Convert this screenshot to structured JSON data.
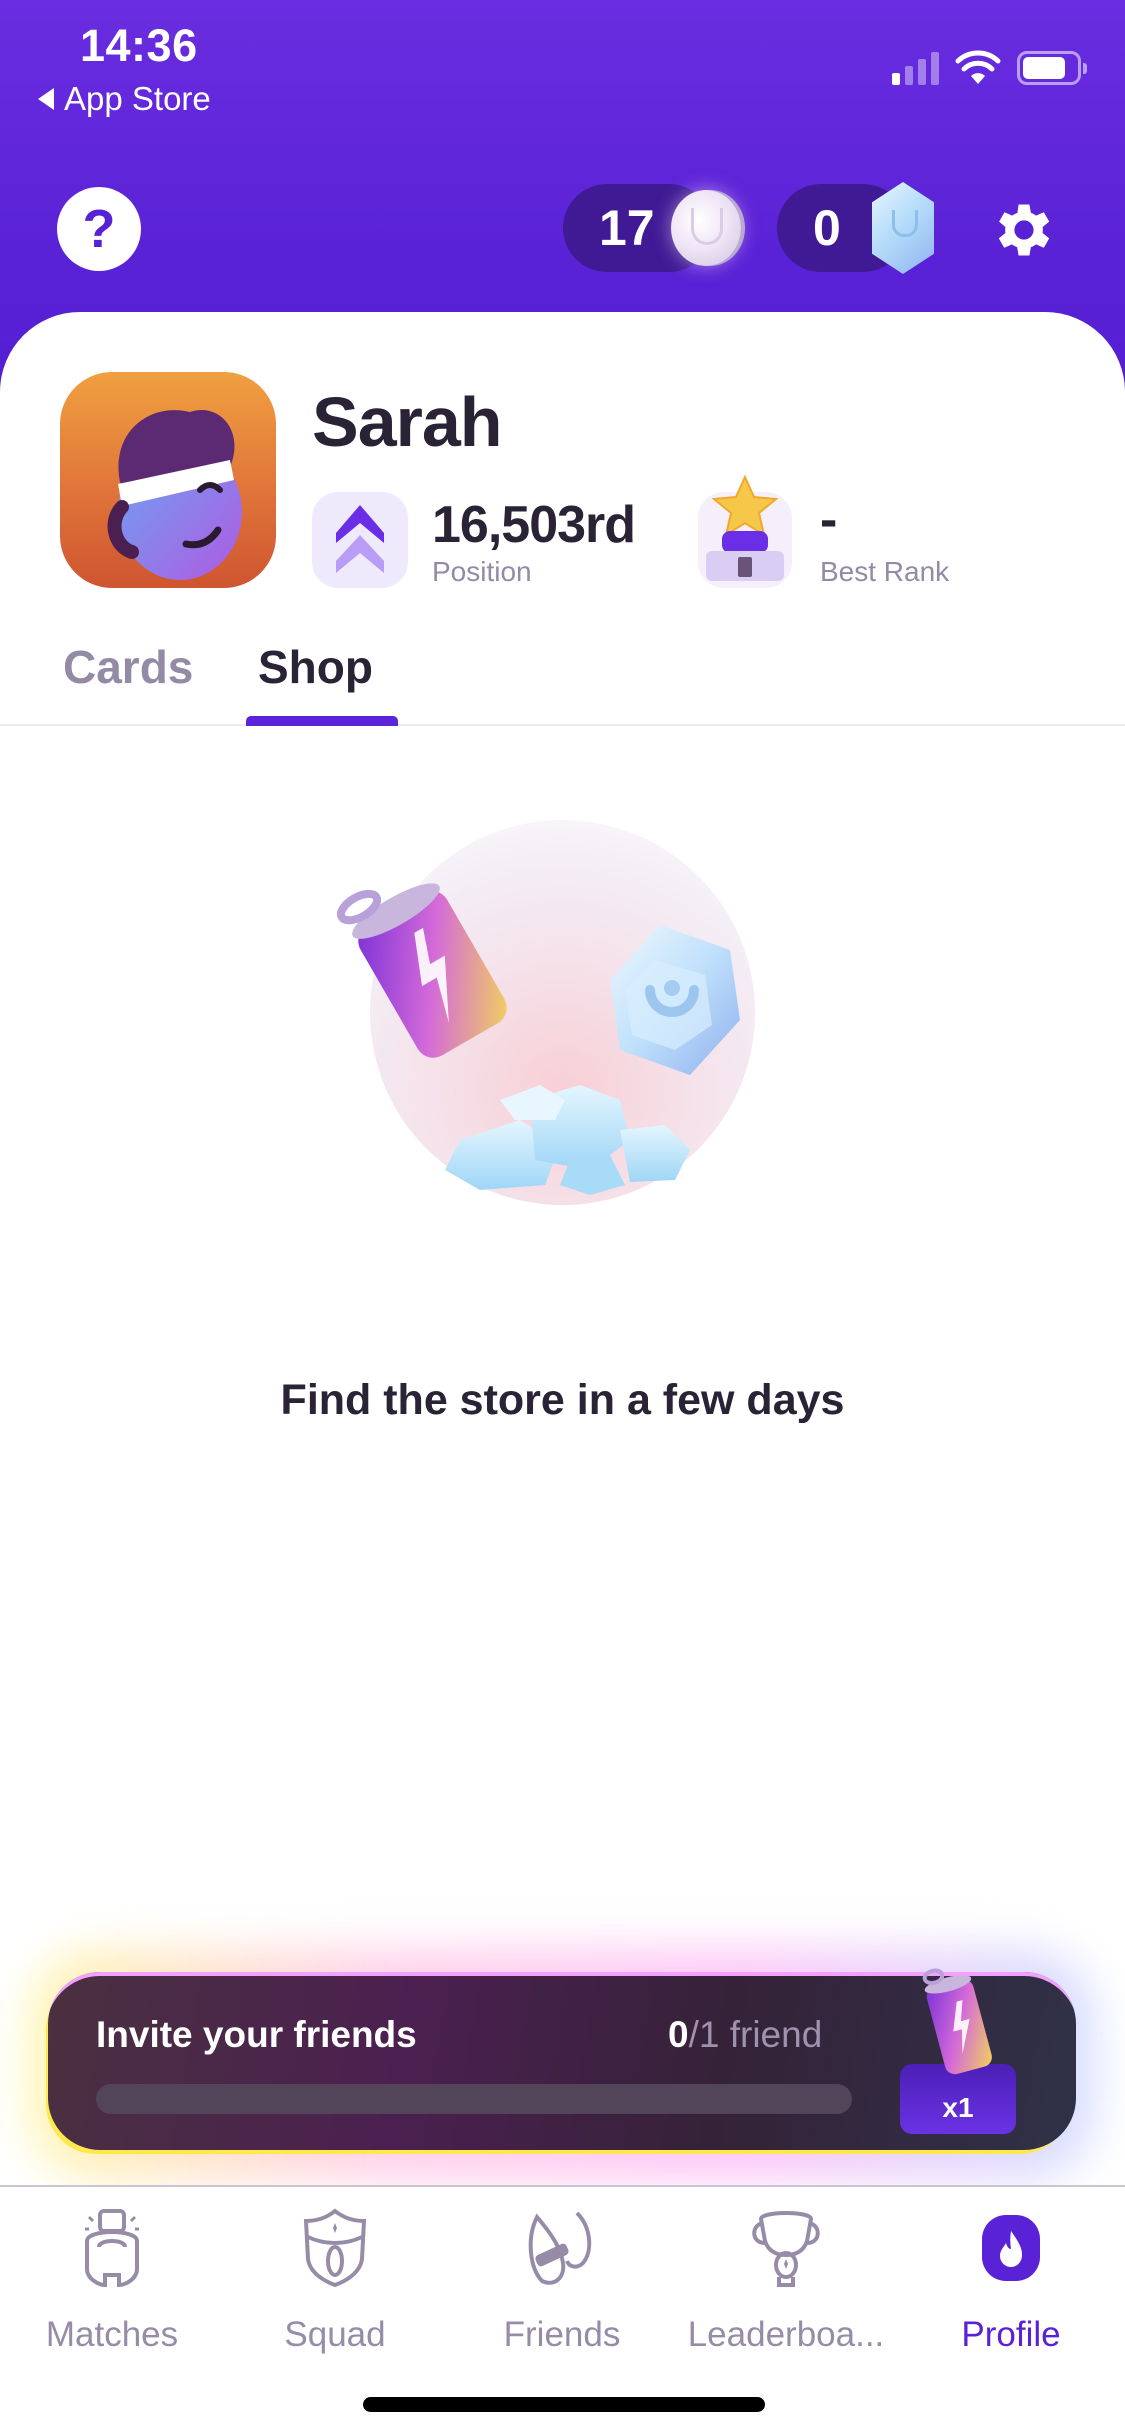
{
  "status_bar": {
    "time": "14:36",
    "back_label": "App Store"
  },
  "header": {
    "help_label": "?",
    "coins": "17",
    "gems": "0"
  },
  "profile": {
    "name": "Sarah",
    "position_value": "16,503rd",
    "position_label": "Position",
    "best_rank_value": "-",
    "best_rank_label": "Best Rank"
  },
  "tabs": [
    {
      "label": "Cards",
      "active": false
    },
    {
      "label": "Shop",
      "active": true
    }
  ],
  "shop": {
    "empty_message": "Find the store in a few days"
  },
  "invite": {
    "title": "Invite your friends",
    "current": "0",
    "goal_text": "/1 friend",
    "progress_fraction": 0,
    "reward_label": "x1"
  },
  "tab_bar": {
    "items": [
      {
        "label": "Matches",
        "icon": "matches-icon",
        "active": false
      },
      {
        "label": "Squad",
        "icon": "squad-shield-icon",
        "active": false
      },
      {
        "label": "Friends",
        "icon": "friends-icon",
        "active": false
      },
      {
        "label": "Leaderboa...",
        "icon": "trophy-icon",
        "active": false
      },
      {
        "label": "Profile",
        "icon": "profile-flame-icon",
        "active": true
      }
    ]
  },
  "colors": {
    "brand_purple": "#5a22d6",
    "text_dark": "#2a2235",
    "text_muted": "#958aa6"
  }
}
